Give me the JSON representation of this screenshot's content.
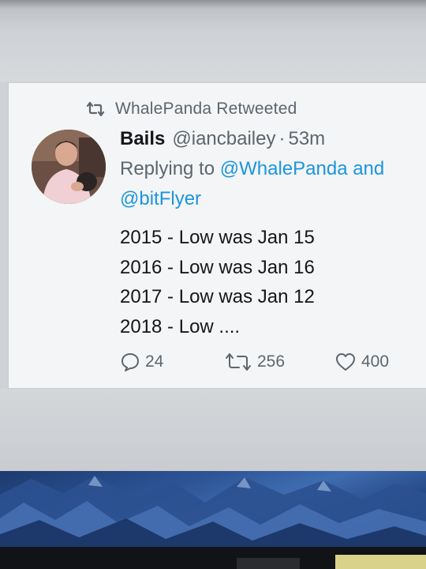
{
  "retweet_banner": {
    "label": "WhalePanda Retweeted",
    "icon": "retweet-icon"
  },
  "tweet": {
    "author_name": "Bails",
    "author_handle": "@iancbailey",
    "separator": "·",
    "time": "53m",
    "replying_prefix": "Replying to ",
    "reply_mentions": [
      "@WhalePanda and",
      "@bitFlyer"
    ],
    "lines": [
      "2015 - Low was Jan 15",
      "2016 - Low was Jan 16",
      "2017 - Low was Jan 12",
      "2018 - Low ...."
    ],
    "actions": {
      "reply": {
        "count": "24",
        "icon": "reply-icon"
      },
      "retweet": {
        "count": "256",
        "icon": "retweet-icon"
      },
      "like": {
        "count": "400",
        "icon": "heart-icon"
      }
    }
  },
  "colors": {
    "link": "#1b95e0",
    "muted": "#5b6670",
    "text": "#14171a"
  }
}
